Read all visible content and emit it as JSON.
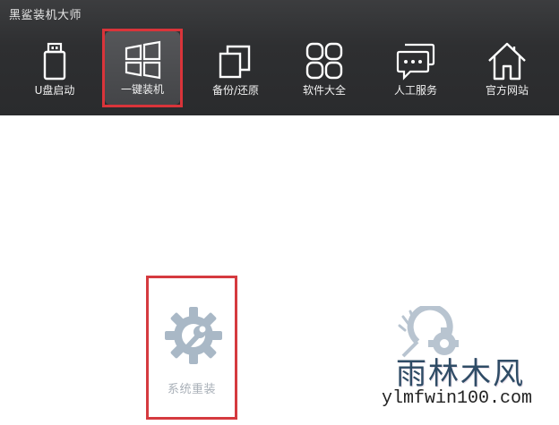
{
  "window": {
    "title": "黑鲨装机大师"
  },
  "nav": {
    "items": [
      {
        "id": "usb",
        "label": "U盘启动",
        "icon": "usb-drive-icon"
      },
      {
        "id": "one-click",
        "label": "一键装机",
        "icon": "windows-logo-icon",
        "active": true
      },
      {
        "id": "backup",
        "label": "备份/还原",
        "icon": "backup-restore-icon"
      },
      {
        "id": "software",
        "label": "软件大全",
        "icon": "apps-grid-icon"
      },
      {
        "id": "service",
        "label": "人工服务",
        "icon": "chat-bubbles-icon"
      },
      {
        "id": "website",
        "label": "官方网站",
        "icon": "home-icon"
      }
    ]
  },
  "main": {
    "options": [
      {
        "id": "reinstall",
        "label": "系统重装",
        "icon": "gear-wrench-icon",
        "highlighted": true
      },
      {
        "id": "repair",
        "label": "",
        "icon": "gear-repair-icon"
      }
    ]
  },
  "watermark": {
    "chinese": "雨林木风",
    "url": "ylmfwin100.com"
  },
  "colors": {
    "topbar": "#2e2f31",
    "highlight_border": "#d9343a",
    "icon_gray": "#a9b8c6"
  }
}
